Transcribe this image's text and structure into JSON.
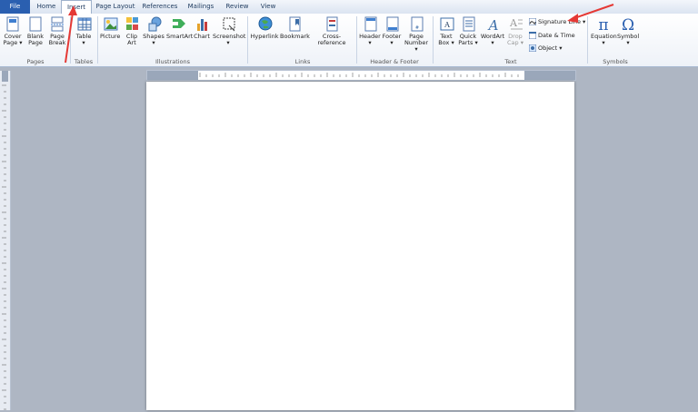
{
  "tabs": [
    {
      "label": "File"
    },
    {
      "label": "Home"
    },
    {
      "label": "Insert"
    },
    {
      "label": "Page Layout"
    },
    {
      "label": "References"
    },
    {
      "label": "Mailings"
    },
    {
      "label": "Review"
    },
    {
      "label": "View"
    }
  ],
  "groups": {
    "pages": {
      "label": "Pages",
      "cover": [
        "Cover",
        "Page"
      ],
      "blank": [
        "Blank",
        "Page"
      ],
      "break": [
        "Page",
        "Break"
      ]
    },
    "tables": {
      "label": "Tables",
      "table": [
        "Table"
      ]
    },
    "illustrations": {
      "label": "Illustrations",
      "picture": [
        "Picture"
      ],
      "clipart": [
        "Clip",
        "Art"
      ],
      "shapes": [
        "Shapes"
      ],
      "smartart": [
        "SmartArt"
      ],
      "chart": [
        "Chart"
      ],
      "screenshot": [
        "Screenshot"
      ]
    },
    "links": {
      "label": "Links",
      "hyperlink": [
        "Hyperlink"
      ],
      "bookmark": [
        "Bookmark"
      ],
      "crossref": [
        "Cross-reference"
      ]
    },
    "header_footer": {
      "label": "Header & Footer",
      "header": [
        "Header"
      ],
      "footer": [
        "Footer"
      ],
      "pagenumber": [
        "Page",
        "Number"
      ]
    },
    "text": {
      "label": "Text",
      "textbox": [
        "Text",
        "Box"
      ],
      "quickparts": [
        "Quick",
        "Parts"
      ],
      "wordart": [
        "WordArt"
      ],
      "dropcap": [
        "Drop",
        "Cap"
      ],
      "signature": "Signature Line",
      "datetime": "Date & Time",
      "object": "Object"
    },
    "symbols": {
      "label": "Symbols",
      "equation": [
        "Equation"
      ],
      "symbol": [
        "Symbol"
      ]
    }
  },
  "colors": {
    "accent": "#2a5fb0",
    "arrow": "#e53935"
  }
}
